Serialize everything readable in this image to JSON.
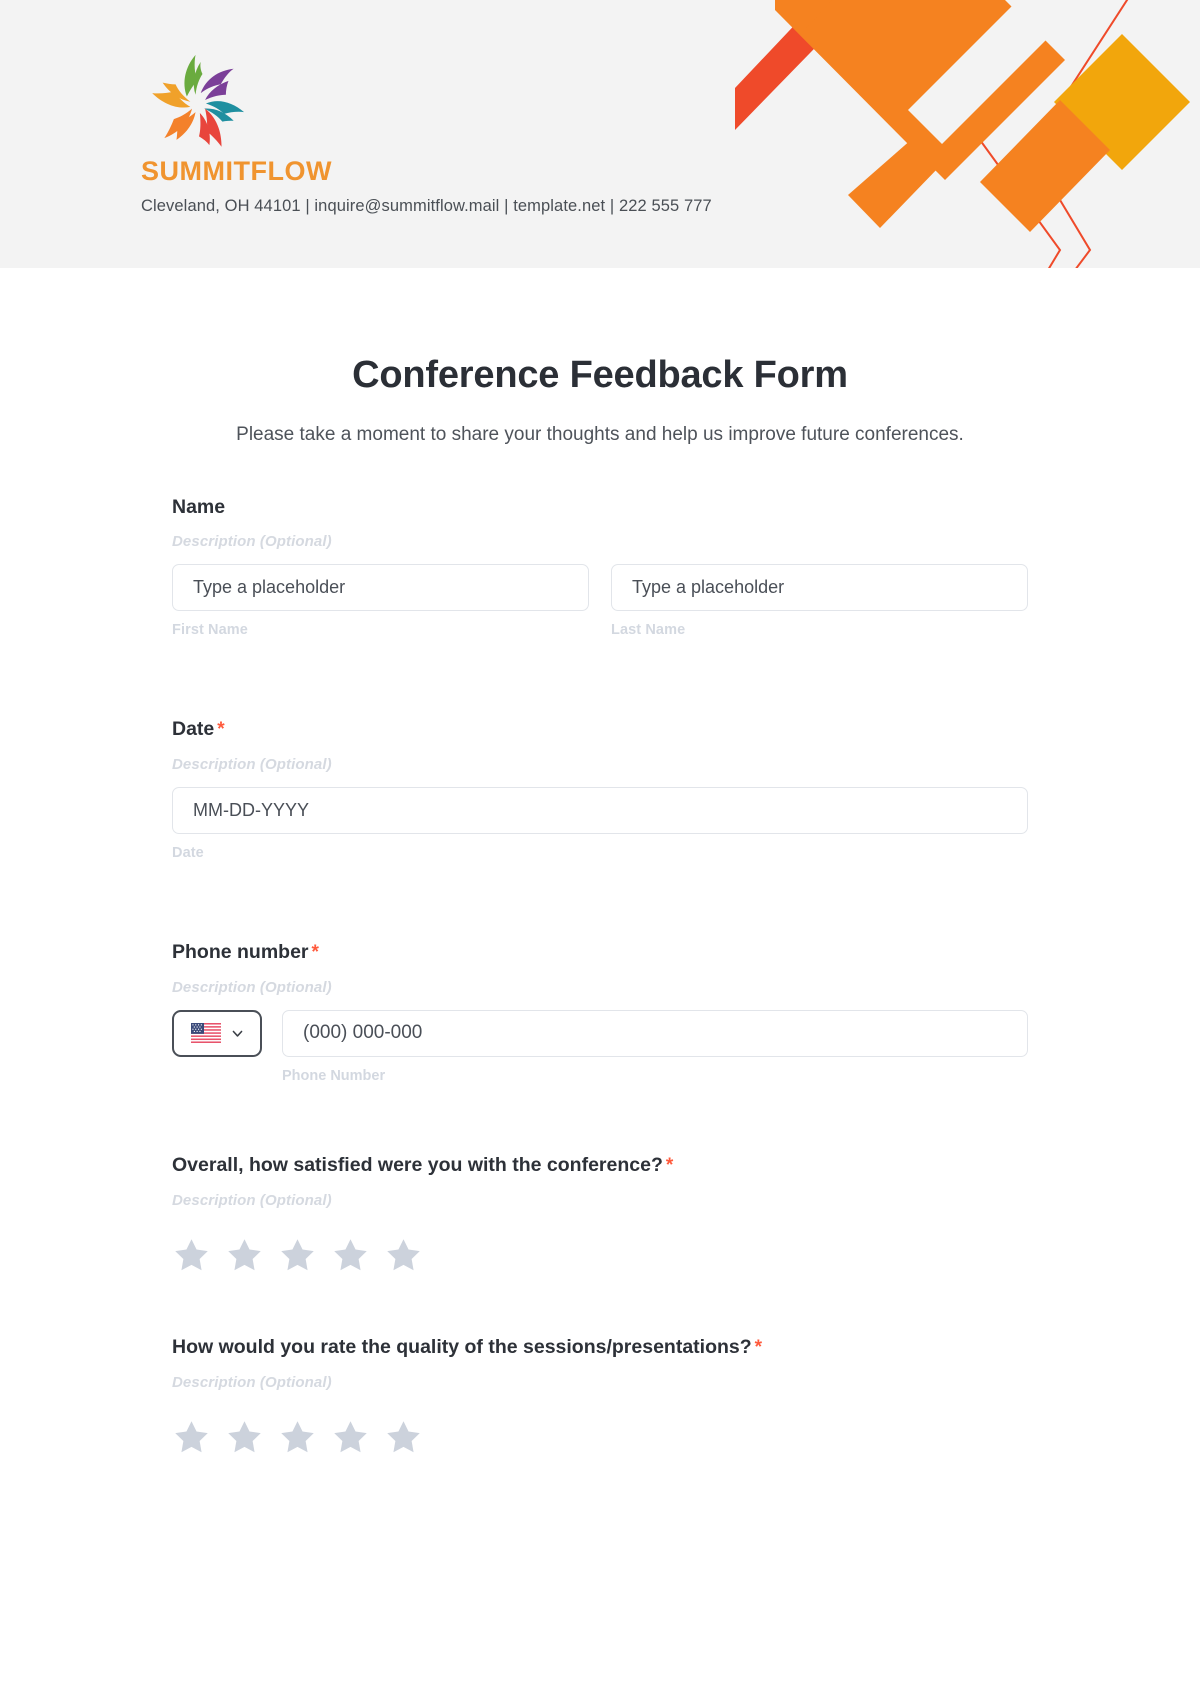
{
  "header": {
    "brand_name": "SUMMITFLOW",
    "contact_line": "Cleveland, OH 44101 | inquire@summitflow.mail | template.net | 222 555 777",
    "logo_icon": "pinwheel-flower-logo-icon",
    "colors": {
      "banner_bg": "#f3f3f3",
      "brand_orange": "#f0942f",
      "deco_orange": "#f58220",
      "deco_red": "#ef4a2a",
      "deco_gold": "#f2a60c"
    }
  },
  "form": {
    "title": "Conference Feedback Form",
    "subtitle": "Please take a moment to share your thoughts and help us improve future conferences.",
    "required_marker": "*",
    "description_placeholder": "Description (Optional)",
    "fields": [
      {
        "label": "Name",
        "required": false,
        "description": "Description (Optional)",
        "type": "name",
        "inputs": [
          {
            "placeholder": "Type a placeholder",
            "value": "Type a placeholder",
            "sub_label": "First Name"
          },
          {
            "placeholder": "Type a placeholder",
            "value": "Type a placeholder",
            "sub_label": "Last Name"
          }
        ]
      },
      {
        "label": "Date",
        "required": true,
        "description": "Description (Optional)",
        "type": "date",
        "inputs": [
          {
            "placeholder": "MM-DD-YYYY",
            "value": "MM-DD-YYYY",
            "sub_label": "Date"
          }
        ]
      },
      {
        "label": "Phone number",
        "required": true,
        "description": "Description (Optional)",
        "type": "phone",
        "country": "US",
        "country_flag_icon": "us-flag-icon",
        "inputs": [
          {
            "placeholder": "(000) 000-000",
            "value": "(000) 000-000",
            "sub_label": "Phone Number"
          }
        ]
      },
      {
        "label": "Overall, how satisfied were you with the conference?",
        "required": true,
        "description": "Description (Optional)",
        "type": "rating",
        "star_count": 5,
        "selected": 0
      },
      {
        "label": "How would you rate the quality of the sessions/presentations?",
        "required": true,
        "description": "Description (Optional)",
        "type": "rating",
        "star_count": 5,
        "selected": 0
      }
    ]
  }
}
